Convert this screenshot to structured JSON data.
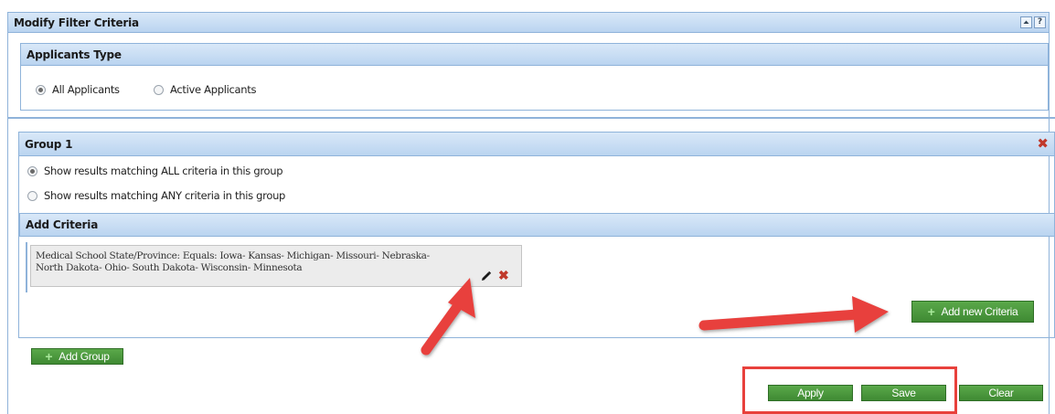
{
  "main_header": {
    "title": "Modify Filter Criteria",
    "collapse_icon": "collapse-icon",
    "help_icon": "help-icon",
    "help_glyph": "?"
  },
  "applicants": {
    "title": "Applicants Type",
    "options": [
      {
        "label": "All Applicants",
        "checked": true
      },
      {
        "label": "Active Applicants",
        "checked": false
      }
    ]
  },
  "group": {
    "title": "Group 1",
    "remove_icon": "close-icon",
    "match_options": [
      {
        "label": "Show results matching ALL criteria in this group",
        "checked": true
      },
      {
        "label": "Show results matching ANY criteria in this group",
        "checked": false
      }
    ],
    "add_criteria_title": "Add Criteria",
    "criteria": {
      "line1": "Medical School State/Province: Equals: Iowa- Kansas- Michigan- Missouri- Nebraska-",
      "line2": "North Dakota- Ohio- South Dakota- Wisconsin- Minnesota",
      "edit_icon": "pencil-icon",
      "delete_icon": "close-icon"
    },
    "add_new_criteria_label": "Add new Criteria"
  },
  "add_group_label": "Add Group",
  "actions": {
    "apply_label": "Apply",
    "save_label": "Save",
    "clear_label": "Clear"
  },
  "colors": {
    "header_blue": "#bad4f0",
    "border_blue": "#8fb3da",
    "button_green": "#4a9a3c",
    "annotation_red": "#e8413c",
    "delete_red": "#c0392b"
  }
}
